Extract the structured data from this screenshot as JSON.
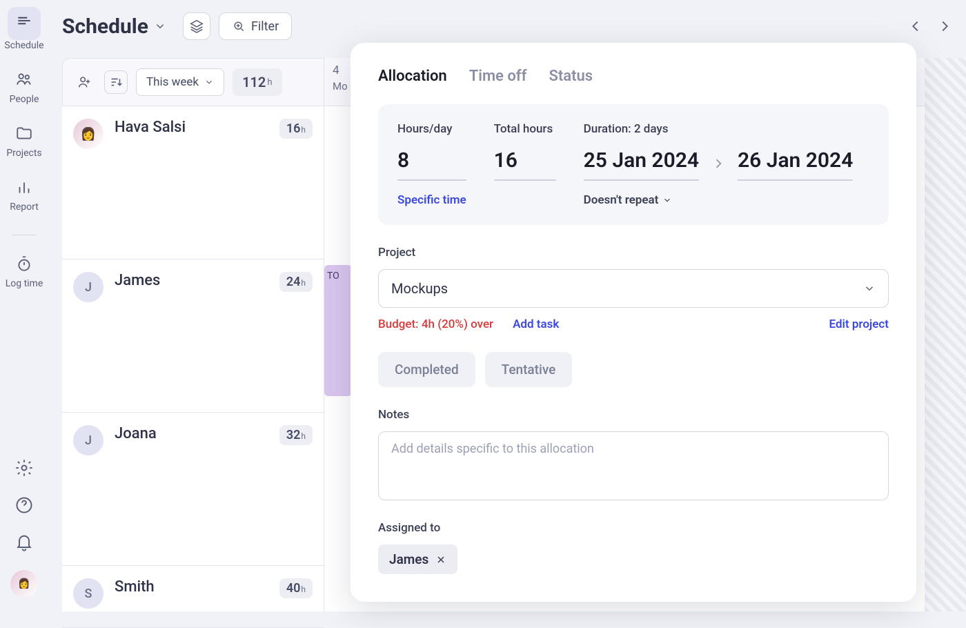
{
  "sidebar": {
    "items": [
      {
        "label": "Schedule"
      },
      {
        "label": "People"
      },
      {
        "label": "Projects"
      },
      {
        "label": "Report"
      },
      {
        "label": "Log time"
      }
    ]
  },
  "header": {
    "title": "Schedule",
    "filter_label": "Filter"
  },
  "toolbar": {
    "week_label": "This week",
    "total_hours": "112",
    "hours_unit": "h"
  },
  "timeline": {
    "week_header": "4",
    "day_header": "Mo",
    "task_label": "TO"
  },
  "people": [
    {
      "name": "Hava Salsi",
      "initial": "",
      "hours": "16",
      "avatar": "photo"
    },
    {
      "name": "James",
      "initial": "J",
      "hours": "24",
      "avatar": "letter"
    },
    {
      "name": "Joana",
      "initial": "J",
      "hours": "32",
      "avatar": "letter"
    },
    {
      "name": "Smith",
      "initial": "S",
      "hours": "40",
      "avatar": "letter"
    }
  ],
  "modal": {
    "tabs": {
      "allocation": "Allocation",
      "timeoff": "Time off",
      "status": "Status"
    },
    "hours_day_label": "Hours/day",
    "hours_day_value": "8",
    "total_hours_label": "Total hours",
    "total_hours_value": "16",
    "duration_label": "Duration: 2 days",
    "start_date": "25 Jan 2024",
    "end_date": "26 Jan 2024",
    "specific_time": "Specific time",
    "repeat": "Doesn't repeat",
    "project_label": "Project",
    "project_value": "Mockups",
    "budget_warn": "Budget: 4h (20%) over",
    "add_task": "Add task",
    "edit_project": "Edit project",
    "completed": "Completed",
    "tentative": "Tentative",
    "notes_label": "Notes",
    "notes_placeholder": "Add details specific to this allocation",
    "assigned_label": "Assigned to",
    "assigned_chip": "James"
  }
}
